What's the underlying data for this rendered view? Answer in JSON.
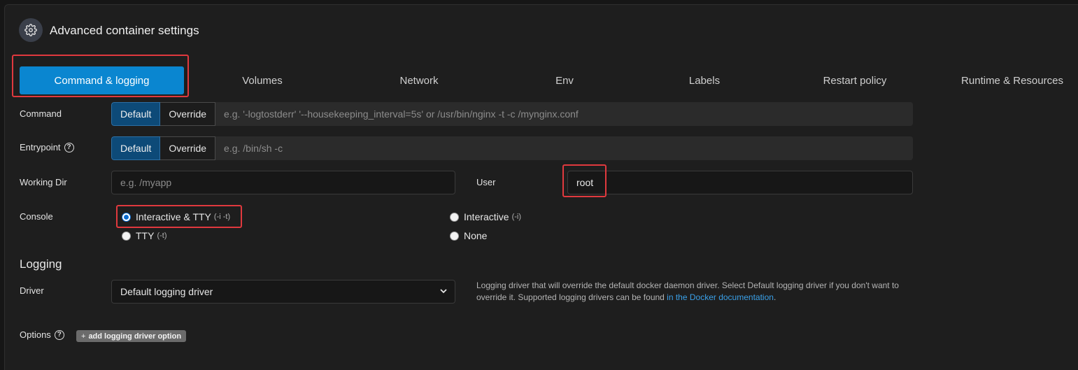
{
  "header": {
    "title": "Advanced container settings",
    "icon": "gear-icon"
  },
  "tabs": [
    {
      "label": "Command & logging",
      "active": true
    },
    {
      "label": "Volumes"
    },
    {
      "label": "Network"
    },
    {
      "label": "Env"
    },
    {
      "label": "Labels"
    },
    {
      "label": "Restart policy"
    },
    {
      "label": "Runtime & Resources"
    }
  ],
  "command": {
    "label": "Command",
    "default_label": "Default",
    "override_label": "Override",
    "placeholder": "e.g. '-logtostderr' '--housekeeping_interval=5s' or /usr/bin/nginx -t -c /mynginx.conf"
  },
  "entrypoint": {
    "label": "Entrypoint",
    "help_icon": "question-icon",
    "default_label": "Default",
    "override_label": "Override",
    "placeholder": "e.g. /bin/sh -c"
  },
  "working_dir": {
    "label": "Working Dir",
    "placeholder": "e.g. /myapp",
    "value": ""
  },
  "user": {
    "label": "User",
    "value": "root"
  },
  "console": {
    "label": "Console",
    "options": [
      {
        "label": "Interactive & TTY",
        "hint": "(-i -t)",
        "checked": true
      },
      {
        "label": "Interactive",
        "hint": "(-i)",
        "checked": false
      },
      {
        "label": "TTY",
        "hint": "(-t)",
        "checked": false
      },
      {
        "label": "None",
        "hint": "",
        "checked": false
      }
    ]
  },
  "logging": {
    "section_title": "Logging",
    "driver_label": "Driver",
    "driver_value": "Default logging driver",
    "help_text_1": "Logging driver that will override the default docker daemon driver. Select Default logging driver if you don't want to override it. Supported logging drivers can be found ",
    "help_link": "in the Docker documentation",
    "help_text_2": ".",
    "options_label": "Options",
    "add_option_label": "add logging driver option"
  },
  "colors": {
    "accent": "#0a86d0",
    "annotation": "#e0393e"
  }
}
